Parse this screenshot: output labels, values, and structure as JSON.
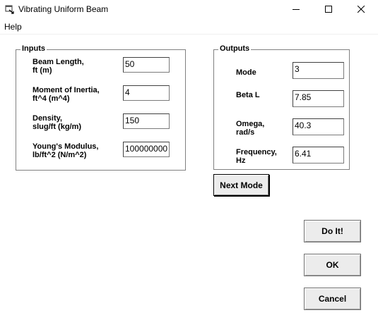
{
  "window": {
    "title": "Vibrating Uniform Beam",
    "icon": "app-window-icon"
  },
  "menu": {
    "items": [
      {
        "label": "Help"
      }
    ]
  },
  "inputs": {
    "group_label": "Inputs",
    "fields": [
      {
        "label": "Beam Length,\nft (m)",
        "value": "50"
      },
      {
        "label": "Moment of Inertia,\nft^4 (m^4)",
        "value": "4"
      },
      {
        "label": "Density,\nslug/ft (kg/m)",
        "value": "150"
      },
      {
        "label": "Young's Modulus,\nlb/ft^2 (N/m^2)",
        "value": "100000000"
      }
    ]
  },
  "outputs": {
    "group_label": "Outputs",
    "fields": [
      {
        "label": "Mode",
        "value": "3"
      },
      {
        "label": "Beta L",
        "value": "7.85"
      },
      {
        "label": "Omega,\nrad/s",
        "value": "40.3"
      },
      {
        "label": "Frequency,\nHz",
        "value": "6.41"
      }
    ]
  },
  "buttons": {
    "next_mode": "Next Mode",
    "do_it": "Do It!",
    "ok": "OK",
    "cancel": "Cancel"
  }
}
